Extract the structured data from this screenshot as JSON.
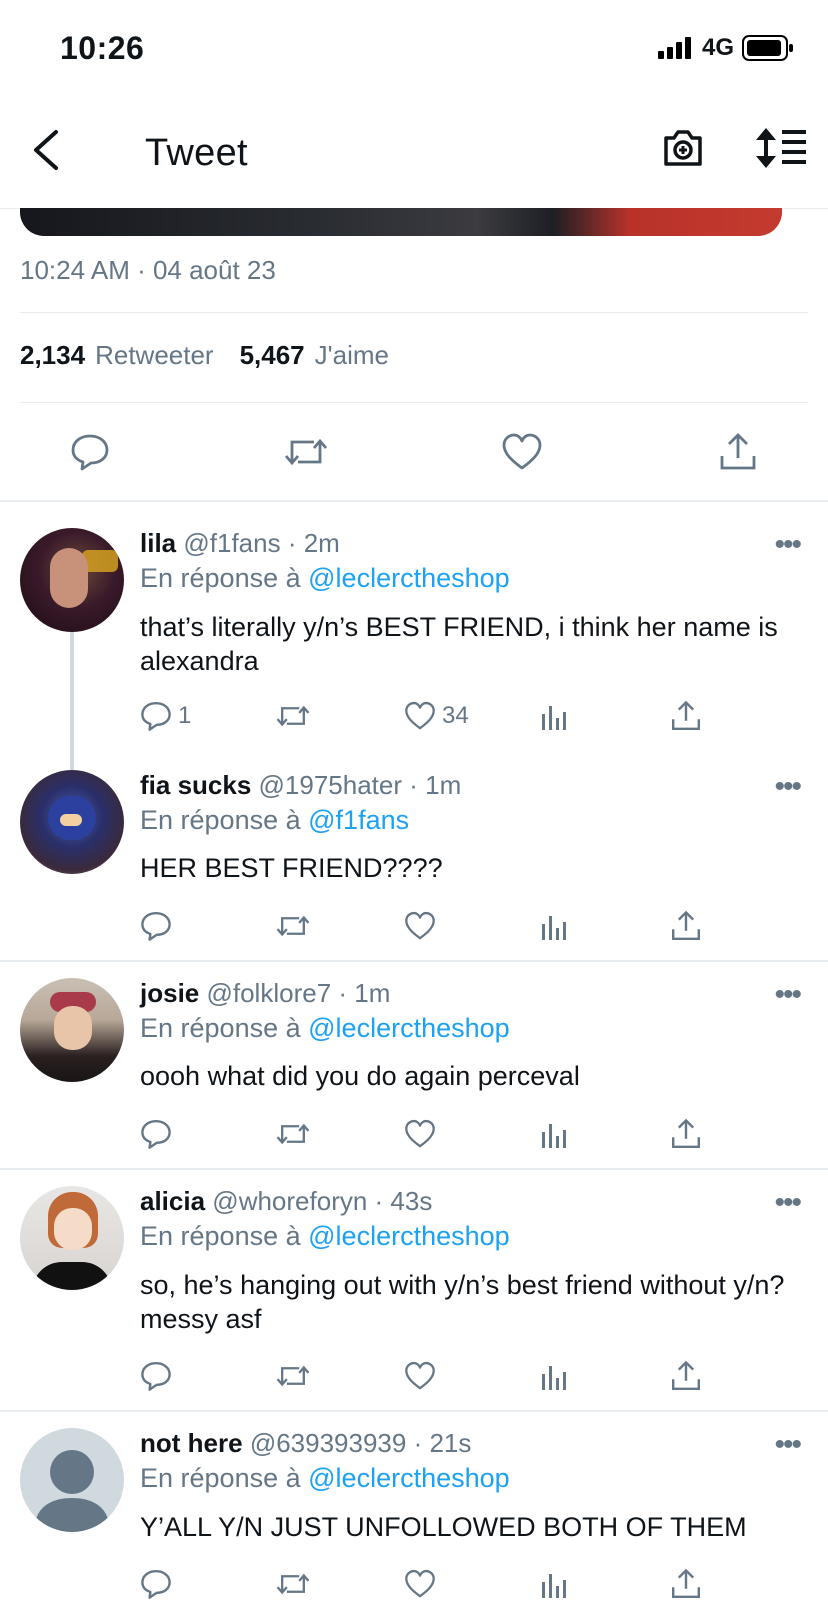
{
  "status": {
    "time": "10:26",
    "network": "4G"
  },
  "header": {
    "title": "Tweet"
  },
  "tweet": {
    "timestamp": "10:24 AM · 04 août 23",
    "retweets_count": "2,134",
    "retweets_label": "Retweeter",
    "likes_count": "5,467",
    "likes_label": "J'aime"
  },
  "replies": [
    {
      "name": "lila",
      "handle": "@f1fans",
      "time": "· 2m",
      "reply_prefix": "En réponse à",
      "reply_to": "@leclerctheshop",
      "text": "that’s literally y/n’s BEST FRIEND, i think her name is alexandra",
      "reply_count": "1",
      "like_count": "34"
    },
    {
      "name": "fia sucks",
      "handle": "@1975hater",
      "time": "· 1m",
      "reply_prefix": "En réponse à",
      "reply_to": "@f1fans",
      "text": "HER BEST FRIEND????",
      "reply_count": "",
      "like_count": ""
    },
    {
      "name": "josie",
      "handle": "@folklore7",
      "time": "· 1m",
      "reply_prefix": "En réponse à",
      "reply_to": "@leclerctheshop",
      "text": "oooh what did you do again perceval",
      "reply_count": "",
      "like_count": ""
    },
    {
      "name": "alicia",
      "handle": "@whoreforyn",
      "time": "· 43s",
      "reply_prefix": "En réponse à",
      "reply_to": "@leclerctheshop",
      "text": "so, he’s hanging out with y/n’s best friend without y/n? messy asf",
      "reply_count": "",
      "like_count": ""
    },
    {
      "name": "not here",
      "handle": "@639393939",
      "time": "· 21s",
      "reply_prefix": "En réponse à",
      "reply_to": "@leclerctheshop",
      "text": "Y’ALL Y/N JUST UNFOLLOWED BOTH OF THEM",
      "reply_count": "",
      "like_count": ""
    }
  ],
  "more_glyph": "•••",
  "colors": {
    "link": "#1da1f2",
    "muted": "#657786",
    "divider": "#e6ecf0"
  }
}
